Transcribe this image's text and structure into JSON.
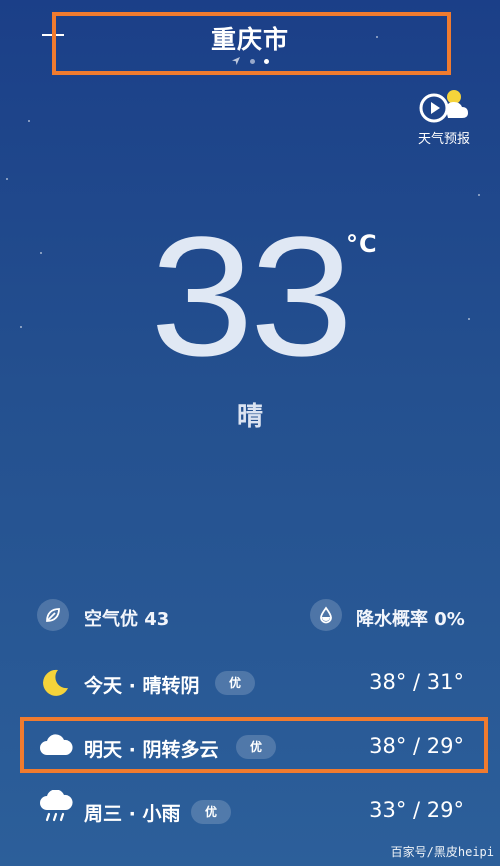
{
  "header": {
    "city": "重庆市",
    "forecast_label": "天气预报"
  },
  "current": {
    "temperature": "33",
    "unit": "°C",
    "condition": "晴"
  },
  "info": {
    "air_quality": "空气优 43",
    "precipitation": "降水概率 0%"
  },
  "forecast": [
    {
      "day": "今天 · 晴转阴",
      "aqi": "优",
      "temps": "38° / 31°",
      "icon": "moon-icon"
    },
    {
      "day": "明天 · 阴转多云",
      "aqi": "优",
      "temps": "38° / 29°",
      "icon": "cloud-icon"
    },
    {
      "day": "周三 · 小雨",
      "aqi": "优",
      "temps": "33° / 29°",
      "icon": "rain-icon"
    }
  ],
  "watermark": "百家号/黑皮heipi",
  "colors": {
    "highlight": "#f07b2f",
    "moon": "#f5d33a",
    "background_top": "#1b3f88",
    "background_bottom": "#2c5f9a"
  }
}
